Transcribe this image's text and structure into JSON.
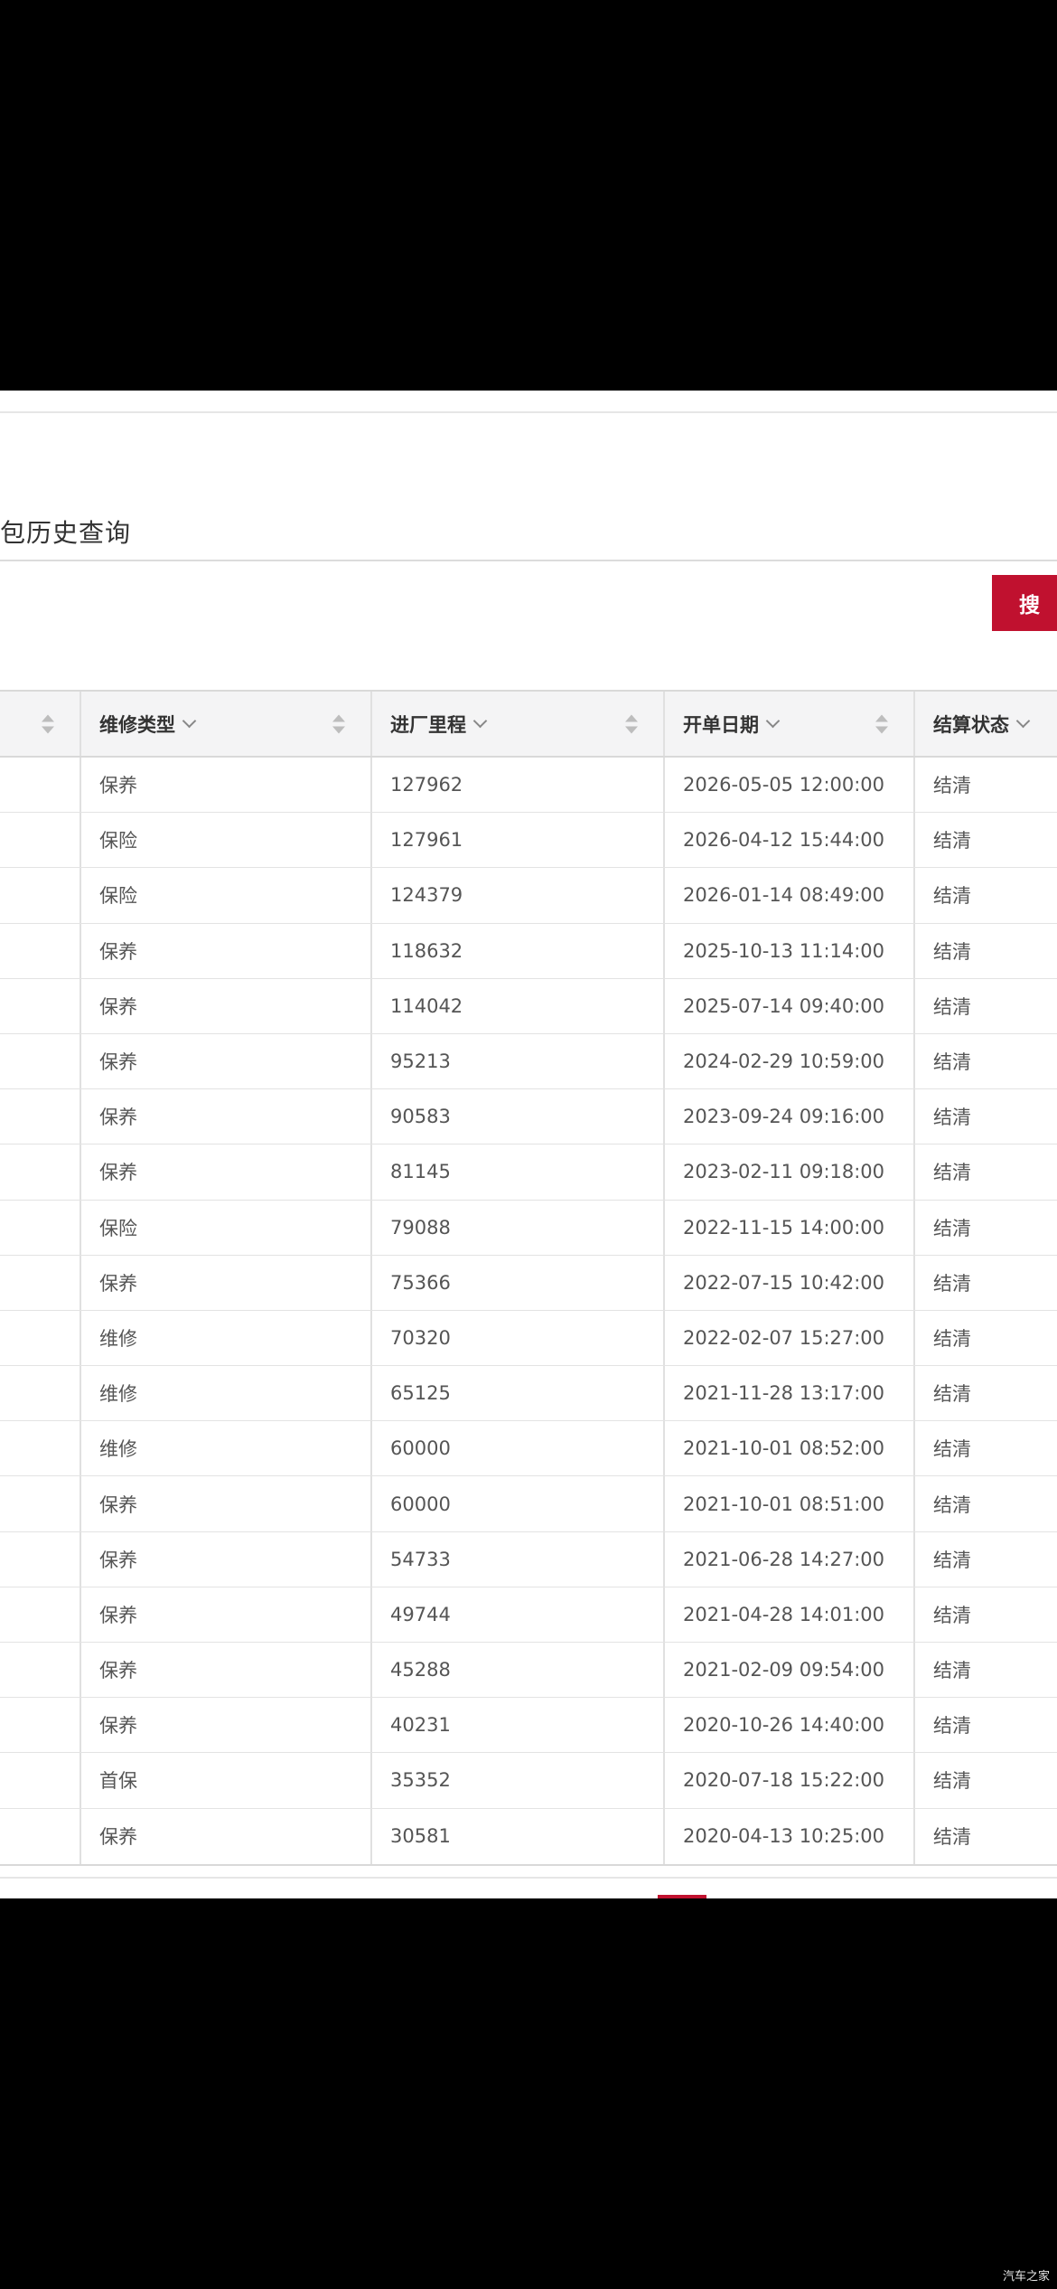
{
  "page": {
    "title": "包历史查询",
    "search_label": "搜 索"
  },
  "table": {
    "headers": [
      "",
      "维修类型",
      "进厂里程",
      "开单日期",
      "结算状态"
    ],
    "rows": [
      [
        "保养",
        "127962",
        "2026-05-05 12:00:00",
        "结清"
      ],
      [
        "保险",
        "127961",
        "2026-04-12 15:44:00",
        "结清"
      ],
      [
        "保险",
        "124379",
        "2026-01-14 08:49:00",
        "结清"
      ],
      [
        "保养",
        "118632",
        "2025-10-13 11:14:00",
        "结清"
      ],
      [
        "保养",
        "114042",
        "2025-07-14 09:40:00",
        "结清"
      ],
      [
        "保养",
        "95213",
        "2024-02-29 10:59:00",
        "结清"
      ],
      [
        "保养",
        "90583",
        "2023-09-24 09:16:00",
        "结清"
      ],
      [
        "保养",
        "81145",
        "2023-02-11 09:18:00",
        "结清"
      ],
      [
        "保险",
        "79088",
        "2022-11-15 14:00:00",
        "结清"
      ],
      [
        "保养",
        "75366",
        "2022-07-15 10:42:00",
        "结清"
      ],
      [
        "维修",
        "70320",
        "2022-02-07 15:27:00",
        "结清"
      ],
      [
        "维修",
        "65125",
        "2021-11-28 13:17:00",
        "结清"
      ],
      [
        "维修",
        "60000",
        "2021-10-01 08:52:00",
        "结清"
      ],
      [
        "保养",
        "60000",
        "2021-10-01 08:51:00",
        "结清"
      ],
      [
        "保养",
        "54733",
        "2021-06-28 14:27:00",
        "结清"
      ],
      [
        "保养",
        "49744",
        "2021-04-28 14:01:00",
        "结清"
      ],
      [
        "保养",
        "45288",
        "2021-02-09 09:54:00",
        "结清"
      ],
      [
        "保养",
        "40231",
        "2020-10-26 14:40:00",
        "结清"
      ],
      [
        "首保",
        "35352",
        "2020-07-18 15:22:00",
        "结清"
      ],
      [
        "保养",
        "30581",
        "2020-04-13 10:25:00",
        "结清"
      ]
    ]
  },
  "watermark": "汽车之家",
  "colors": {
    "accent": "#c0112f",
    "header_bg": "#f4f4f5",
    "border": "#d9d9d9"
  }
}
